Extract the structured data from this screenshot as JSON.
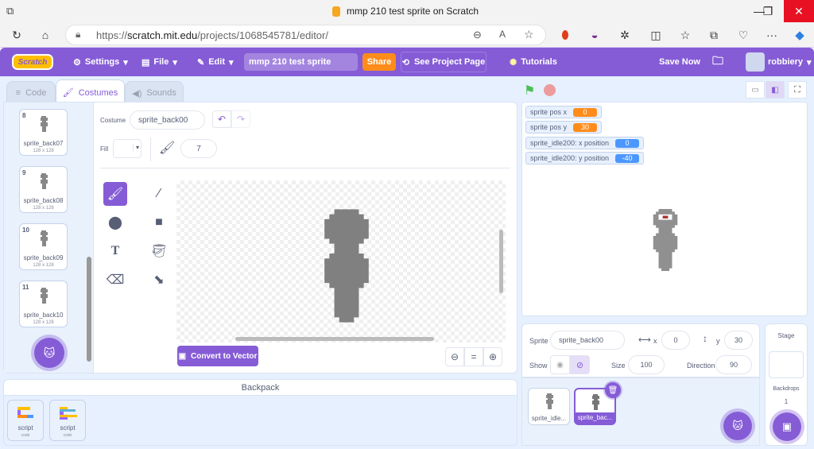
{
  "browser": {
    "tab_title": "mmp 210 test sprite on Scratch",
    "url_prefix": "https://",
    "url_domain": "scratch.mit.edu",
    "url_path": "/projects/1068545781/editor/",
    "window_controls": {
      "minimize": "—",
      "restore": "❐",
      "close": "✕"
    },
    "toolbar_icons": [
      "refresh-icon",
      "home-icon",
      "zoom-out-icon",
      "read-aloud-icon",
      "favorite-star-icon",
      "extension-red-icon",
      "extension-purple-icon",
      "extensions-icon",
      "split-screen-icon",
      "favorites-icon",
      "collections-icon",
      "browser-essentials-icon",
      "more-icon",
      "copilot-icon"
    ],
    "more_label": "···"
  },
  "menubar": {
    "logo": "Scratch",
    "settings": "Settings",
    "file": "File",
    "edit": "Edit",
    "project_title": "mmp 210 test sprite",
    "share": "Share",
    "see_project_page": "See Project Page",
    "tutorials": "Tutorials",
    "save_now": "Save Now",
    "username": "robbiery"
  },
  "tabs": [
    {
      "label": "Code",
      "active": false
    },
    {
      "label": "Costumes",
      "active": true
    },
    {
      "label": "Sounds",
      "active": false
    }
  ],
  "costumes": [
    {
      "num": "8",
      "name": "sprite_back07",
      "size": "128 x 128"
    },
    {
      "num": "9",
      "name": "sprite_back08",
      "size": "128 x 128"
    },
    {
      "num": "10",
      "name": "sprite_back09",
      "size": "128 x 128"
    },
    {
      "num": "11",
      "name": "sprite_back10",
      "size": "128 x 128"
    }
  ],
  "paint": {
    "costume_label": "Costume",
    "costume_name": "sprite_back00",
    "fill_label": "Fill",
    "brush_size": "7",
    "convert_label": "Convert to Vector",
    "zoom_reset": "="
  },
  "backpack": {
    "title": "Backpack",
    "items": [
      {
        "name": "script",
        "type": "code"
      },
      {
        "name": "script",
        "type": "code"
      }
    ]
  },
  "monitors": [
    {
      "label": "sprite pos x",
      "value": "0",
      "color": "#ff8c1a"
    },
    {
      "label": "sprite pos y",
      "value": "30",
      "color": "#ff8c1a"
    },
    {
      "label": "sprite_idle200: x position",
      "value": "0",
      "color": "#4c97ff"
    },
    {
      "label": "sprite_idle200: y position",
      "value": "-40",
      "color": "#4c97ff"
    }
  ],
  "sprite_info": {
    "sprite_label": "Sprite",
    "sprite_name": "sprite_back00",
    "x_label": "x",
    "x": "0",
    "y_label": "y",
    "y": "30",
    "show_label": "Show",
    "size_label": "Size",
    "size": "100",
    "direction_label": "Direction",
    "direction": "90"
  },
  "sprites": [
    {
      "name": "sprite_idle...",
      "selected": false
    },
    {
      "name": "sprite_bac...",
      "selected": true
    }
  ],
  "stage_panel": {
    "title": "Stage",
    "backdrops_label": "Backdrops",
    "backdrops_count": "1"
  },
  "colors": {
    "accent": "#855cd6",
    "share": "#ff8c1a",
    "variable": "#ff8c1a",
    "motion": "#4c97ff"
  }
}
